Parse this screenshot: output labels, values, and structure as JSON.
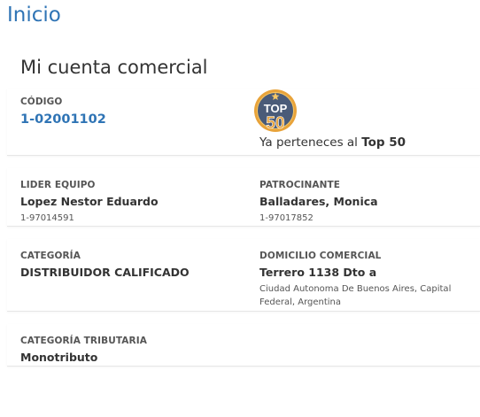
{
  "header": {
    "title": "Inicio"
  },
  "account": {
    "title": "Mi cuenta comercial",
    "code_label": "CÓDIGO",
    "code_value": "1-02001102",
    "badge": {
      "top_text": "TOP",
      "number_text": "50",
      "icon": "top50-badge-icon"
    },
    "top50_prefix": "Ya perteneces al ",
    "top50_bold": "Top 50",
    "leader_label": "LIDER EQUIPO",
    "leader_name": "Lopez Nestor Eduardo",
    "leader_code": "1-97014591",
    "sponsor_label": "PATROCINANTE",
    "sponsor_name": "Balladares, Monica",
    "sponsor_code": "1-97017852",
    "category_label": "CATEGORÍA",
    "category_value": "DISTRIBUIDOR CALIFICADO",
    "address_label": "DOMICILIO COMERCIAL",
    "address_street": "Terrero 1138 Dto a",
    "address_city": "Ciudad Autonoma De Buenos Aires, Capital Federal, Argentina",
    "tax_label": "CATEGORÍA TRIBUTARIA",
    "tax_value": "Monotributo"
  },
  "colors": {
    "accent": "#2f74b5",
    "badge_gold": "#e8a33a",
    "badge_blue": "#4a5b78"
  }
}
